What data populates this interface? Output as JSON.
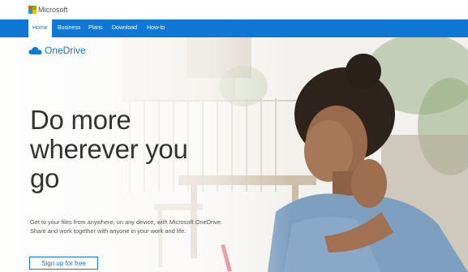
{
  "header": {
    "brand": "Microsoft",
    "logo_colors": [
      "#f25022",
      "#7fba00",
      "#00a4ef",
      "#ffb900"
    ]
  },
  "nav": {
    "items": [
      {
        "label": "Home",
        "active": true
      },
      {
        "label": "Business",
        "active": false
      },
      {
        "label": "Plans",
        "active": false
      },
      {
        "label": "Download",
        "active": false
      },
      {
        "label": "How-to",
        "active": false
      }
    ]
  },
  "product": {
    "name": "OneDrive",
    "icon": "cloud-icon"
  },
  "hero": {
    "headline_lines": [
      "Do more",
      "wherever you",
      "go"
    ],
    "description": "Get to your files from anywhere, on any device, with Microsoft OneDrive. Share and work together with anyone in your work and life.",
    "cta_label": "Sign up for free"
  },
  "colors": {
    "accent": "#0f78d4",
    "text": "#333333"
  }
}
